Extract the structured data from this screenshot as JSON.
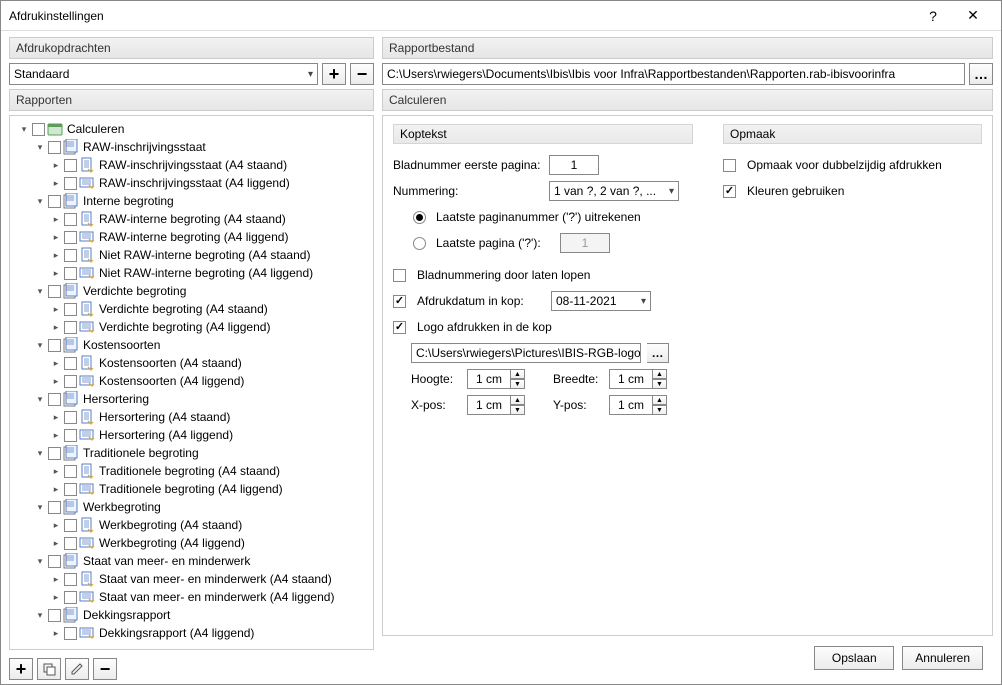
{
  "window": {
    "title": "Afdrukinstellingen"
  },
  "left": {
    "section_orders": "Afdrukopdrachten",
    "orders_selected": "Standaard",
    "section_reports": "Rapporten",
    "root": "Calculeren"
  },
  "tree": [
    {
      "d": 0,
      "tw": "exp",
      "ico": "root",
      "label": "Calculeren"
    },
    {
      "d": 1,
      "tw": "exp",
      "ico": "group",
      "label": "RAW-inschrijvingsstaat"
    },
    {
      "d": 2,
      "tw": "col",
      "ico": "portrait",
      "label": "RAW-inschrijvingsstaat (A4 staand)"
    },
    {
      "d": 2,
      "tw": "col",
      "ico": "landscape",
      "label": "RAW-inschrijvingsstaat (A4 liggend)"
    },
    {
      "d": 1,
      "tw": "exp",
      "ico": "group",
      "label": "Interne begroting"
    },
    {
      "d": 2,
      "tw": "col",
      "ico": "portrait",
      "label": "RAW-interne begroting (A4 staand)"
    },
    {
      "d": 2,
      "tw": "col",
      "ico": "landscape",
      "label": "RAW-interne begroting (A4 liggend)"
    },
    {
      "d": 2,
      "tw": "col",
      "ico": "portrait",
      "label": "Niet RAW-interne begroting (A4 staand)"
    },
    {
      "d": 2,
      "tw": "col",
      "ico": "landscape",
      "label": "Niet RAW-interne begroting (A4 liggend)"
    },
    {
      "d": 1,
      "tw": "exp",
      "ico": "group",
      "label": "Verdichte begroting"
    },
    {
      "d": 2,
      "tw": "col",
      "ico": "portrait",
      "label": "Verdichte begroting (A4 staand)"
    },
    {
      "d": 2,
      "tw": "col",
      "ico": "landscape",
      "label": "Verdichte begroting (A4 liggend)"
    },
    {
      "d": 1,
      "tw": "exp",
      "ico": "group",
      "label": "Kostensoorten"
    },
    {
      "d": 2,
      "tw": "col",
      "ico": "portrait",
      "label": "Kostensoorten (A4 staand)"
    },
    {
      "d": 2,
      "tw": "col",
      "ico": "landscape",
      "label": "Kostensoorten (A4 liggend)"
    },
    {
      "d": 1,
      "tw": "exp",
      "ico": "group",
      "label": "Hersortering"
    },
    {
      "d": 2,
      "tw": "col",
      "ico": "portrait",
      "label": "Hersortering (A4 staand)"
    },
    {
      "d": 2,
      "tw": "col",
      "ico": "landscape",
      "label": "Hersortering (A4 liggend)"
    },
    {
      "d": 1,
      "tw": "exp",
      "ico": "group",
      "label": "Traditionele begroting"
    },
    {
      "d": 2,
      "tw": "col",
      "ico": "portrait",
      "label": "Traditionele begroting (A4 staand)"
    },
    {
      "d": 2,
      "tw": "col",
      "ico": "landscape",
      "label": "Traditionele begroting (A4 liggend)"
    },
    {
      "d": 1,
      "tw": "exp",
      "ico": "group",
      "label": "Werkbegroting"
    },
    {
      "d": 2,
      "tw": "col",
      "ico": "portrait",
      "label": "Werkbegroting (A4 staand)"
    },
    {
      "d": 2,
      "tw": "col",
      "ico": "landscape",
      "label": "Werkbegroting (A4 liggend)"
    },
    {
      "d": 1,
      "tw": "exp",
      "ico": "group",
      "label": "Staat van meer- en minderwerk"
    },
    {
      "d": 2,
      "tw": "col",
      "ico": "portrait",
      "label": "Staat van meer- en minderwerk (A4 staand)"
    },
    {
      "d": 2,
      "tw": "col",
      "ico": "landscape",
      "label": "Staat van meer- en minderwerk (A4 liggend)"
    },
    {
      "d": 1,
      "tw": "exp",
      "ico": "group",
      "label": "Dekkingsrapport"
    },
    {
      "d": 2,
      "tw": "col",
      "ico": "landscape",
      "label": "Dekkingsrapport (A4 liggend)"
    }
  ],
  "right": {
    "section_file": "Rapportbestand",
    "file_path": "C:\\Users\\rwiegers\\Documents\\Ibis\\Ibis voor Infra\\Rapportbestanden\\Rapporten.rab-ibisvoorinfra",
    "section_calc": "Calculeren",
    "koptekst": {
      "header": "Koptekst",
      "bladnummer_label": "Bladnummer eerste pagina:",
      "bladnummer_value": "1",
      "nummering_label": "Nummering:",
      "nummering_value": "1 van ?, 2 van ?, ...",
      "radio_uitrekenen": "Laatste paginanummer ('?') uitrekenen",
      "radio_laatste": "Laatste pagina ('?'):",
      "radio_laatste_value": "1",
      "chk_doorlopen": "Bladnummering door laten lopen",
      "chk_afdrukdatum": "Afdrukdatum in kop:",
      "afdrukdatum_value": "08-11-2021",
      "chk_logo": "Logo afdrukken in de kop",
      "logo_path": "C:\\Users\\rwiegers\\Pictures\\IBIS-RGB-logo-onl",
      "hoogte_label": "Hoogte:",
      "hoogte_value": "1 cm",
      "breedte_label": "Breedte:",
      "breedte_value": "1 cm",
      "xpos_label": "X-pos:",
      "xpos_value": "1 cm",
      "ypos_label": "Y-pos:",
      "ypos_value": "1 cm"
    },
    "opmaak": {
      "header": "Opmaak",
      "chk_dubbelzijdig": "Opmaak voor dubbelzijdig afdrukken",
      "chk_kleuren": "Kleuren gebruiken"
    }
  },
  "footer": {
    "save": "Opslaan",
    "cancel": "Annuleren"
  }
}
